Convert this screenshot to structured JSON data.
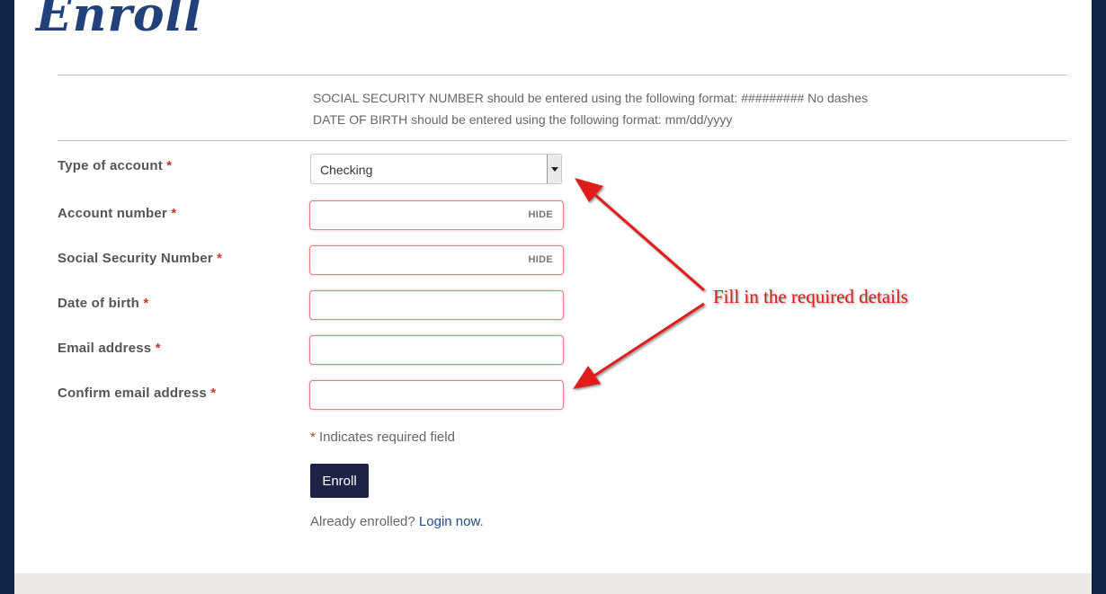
{
  "logo": {
    "text": "Enroll"
  },
  "notes": [
    "SOCIAL SECURITY NUMBER should be entered using the following format: ######### No dashes",
    "DATE OF BIRTH should be entered using the following format: mm/dd/yyyy"
  ],
  "form": {
    "required_mark": "*",
    "account_type": {
      "label": "Type of account",
      "selected": "Checking"
    },
    "account_number": {
      "label": "Account number",
      "value": "",
      "toggle": "HIDE"
    },
    "ssn": {
      "label": "Social Security Number",
      "value": "",
      "toggle": "HIDE"
    },
    "dob": {
      "label": "Date of birth",
      "value": ""
    },
    "email": {
      "label": "Email address",
      "value": ""
    },
    "confirm_email": {
      "label": "Confirm email address",
      "value": ""
    },
    "required_note": "Indicates required field",
    "submit_label": "Enroll",
    "already_text": "Already enrolled?",
    "login_link": "Login now",
    "login_suffix": "."
  },
  "annotation": {
    "text": "Fill in the required details"
  },
  "colors": {
    "page_bg": "#0e2545",
    "button_bg": "#1e2247",
    "required": "#c0392b",
    "annotation": "#e01b1b",
    "link": "#1d4f8c"
  }
}
